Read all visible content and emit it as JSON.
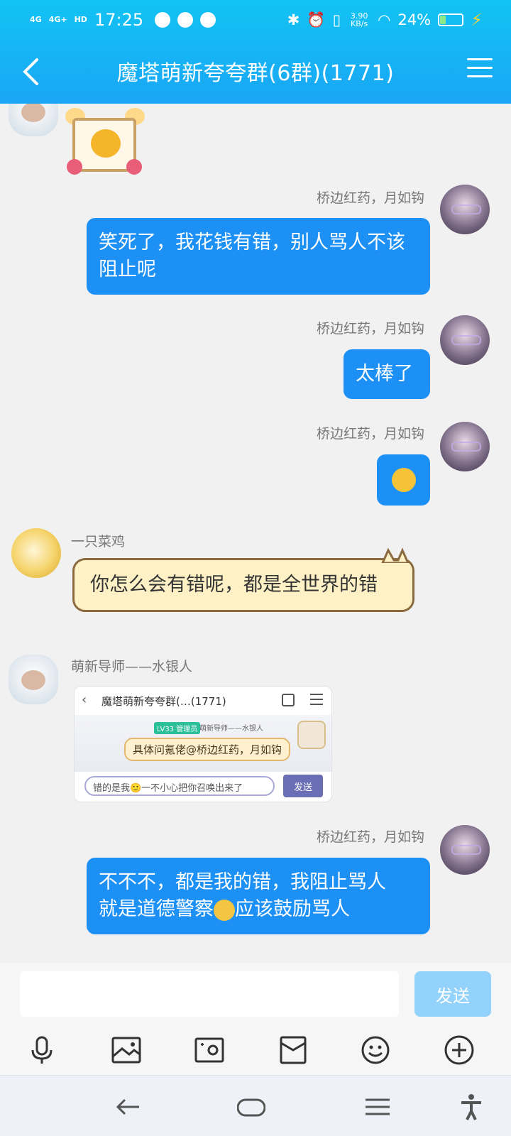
{
  "status_bar": {
    "signal_1": "4G",
    "signal_2": "4G+",
    "hd": "HD",
    "time": "17:25",
    "net_speed": "3.90 KB/s",
    "battery": "24%"
  },
  "header": {
    "title": "魔塔萌新夸夸群(6群)(1771)"
  },
  "messages": [
    {
      "sender": "",
      "type": "sticker"
    },
    {
      "sender": "桥边红药，月如钩",
      "text": "笑死了，我花钱有错，别人骂人不该阻止呢"
    },
    {
      "sender": "桥边红药，月如钩",
      "text": "太棒了"
    },
    {
      "sender": "桥边红药，月如钩",
      "type": "emoji"
    },
    {
      "sender": "一只菜鸡",
      "text": "你怎么会有错呢，都是全世界的错"
    },
    {
      "sender": "萌新导师——水银人",
      "type": "image",
      "image": {
        "title": "魔塔萌新夸夸群(…(1771)",
        "tag": "LV33 管理员",
        "nick": "萌新导师——水银人",
        "bubble": "具体问氪佬@桥边红药，月如钩",
        "input": "错的是我🙂一不小心把你召唤出来了",
        "send": "发送"
      }
    },
    {
      "sender": "桥边红药，月如钩",
      "text_a": "不不不，都是我的错，我阻止骂人",
      "text_b": "就是道德警察",
      "text_c": "应该鼓励骂人"
    }
  ],
  "input": {
    "value": "",
    "send_label": "发送"
  },
  "toolbar": [
    "mic-icon",
    "image-icon",
    "camera-icon",
    "red-packet-icon",
    "emoji-icon",
    "plus-icon"
  ],
  "colors": {
    "header": "#1aa6f5",
    "bubble_self": "#1c90f5",
    "send_disabled": "#93d2fb"
  }
}
